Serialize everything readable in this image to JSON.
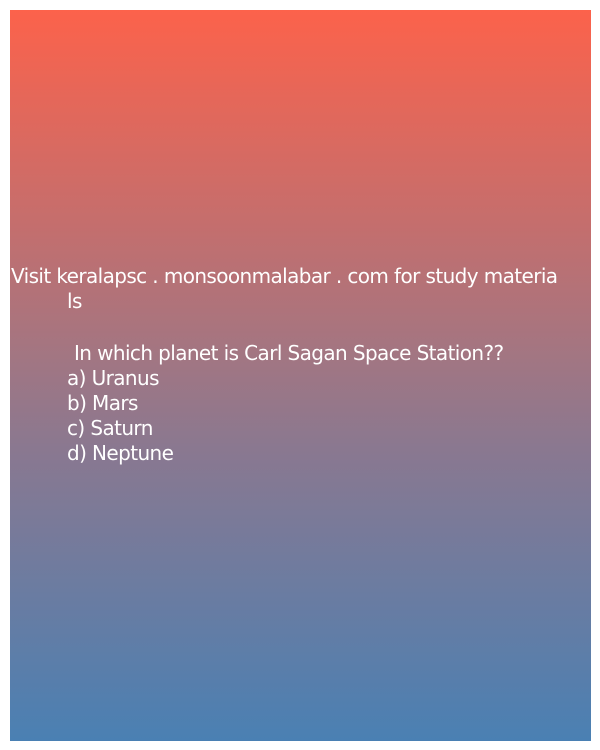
{
  "promo": {
    "line1": "Visit keralapsc . monsoonmalabar . com for study materia",
    "line2": "ls"
  },
  "question": "In which planet is Carl Sagan Space Station??",
  "options": [
    "a) Uranus",
    "b) Mars",
    "c) Saturn",
    "d) Neptune"
  ],
  "colors": {
    "gradient_top": "#fc624b",
    "gradient_bottom": "#4a80b3",
    "text": "#ffffff"
  }
}
